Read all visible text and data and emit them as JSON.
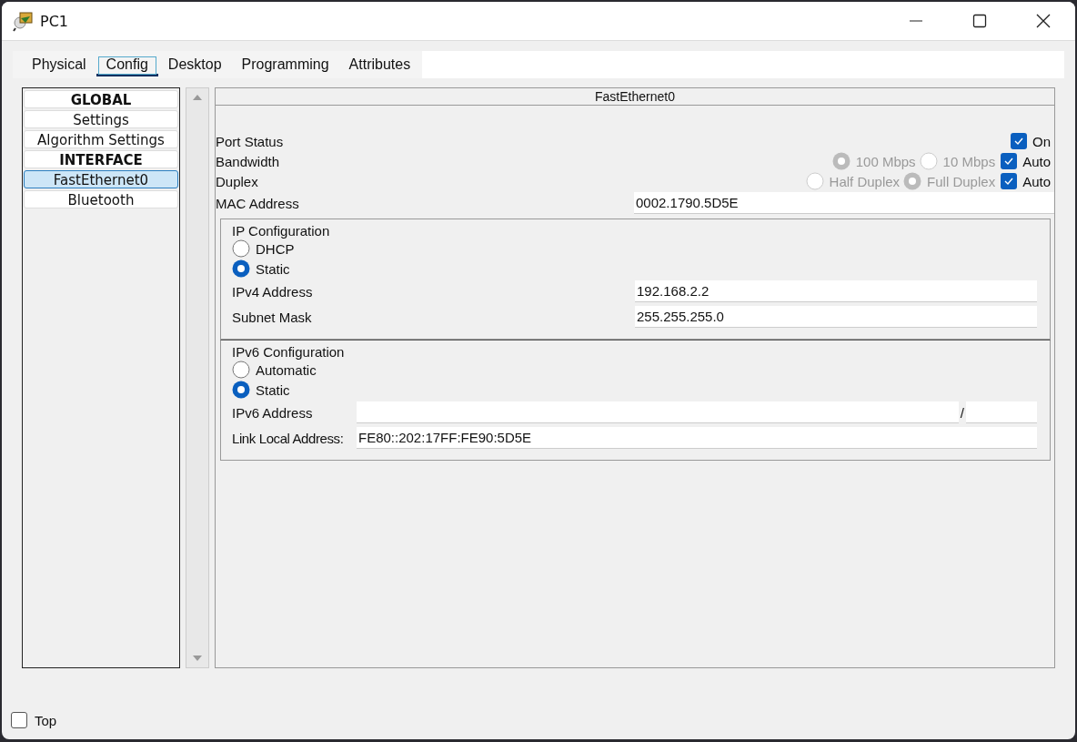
{
  "window": {
    "title": "PC1"
  },
  "tabs": [
    {
      "label": "Physical",
      "selected": false
    },
    {
      "label": "Config",
      "selected": true
    },
    {
      "label": "Desktop",
      "selected": false
    },
    {
      "label": "Programming",
      "selected": false
    },
    {
      "label": "Attributes",
      "selected": false
    }
  ],
  "sidebar": {
    "items": [
      {
        "label": "GLOBAL",
        "kind": "heading",
        "selected": false
      },
      {
        "label": "Settings",
        "kind": "item",
        "selected": false
      },
      {
        "label": "Algorithm Settings",
        "kind": "item",
        "selected": false
      },
      {
        "label": "INTERFACE",
        "kind": "heading",
        "selected": false
      },
      {
        "label": "FastEthernet0",
        "kind": "item",
        "selected": true
      },
      {
        "label": "Bluetooth",
        "kind": "item",
        "selected": false
      }
    ]
  },
  "panel": {
    "title": "FastEthernet0",
    "port_status": {
      "label": "Port Status",
      "checkbox": {
        "label": "On",
        "checked": true
      }
    },
    "bandwidth": {
      "label": "Bandwidth",
      "disabled": true,
      "options": [
        {
          "label": "100 Mbps",
          "selected": true
        },
        {
          "label": "10 Mbps",
          "selected": false
        }
      ],
      "auto": {
        "label": "Auto",
        "checked": true
      }
    },
    "duplex": {
      "label": "Duplex",
      "disabled": true,
      "options": [
        {
          "label": "Half Duplex",
          "selected": false
        },
        {
          "label": "Full Duplex",
          "selected": true
        }
      ],
      "auto": {
        "label": "Auto",
        "checked": true
      }
    },
    "mac_address": {
      "label": "MAC Address",
      "value": "0002.1790.5D5E"
    },
    "ip_configuration": {
      "title": "IP Configuration",
      "modes": [
        {
          "label": "DHCP",
          "selected": false
        },
        {
          "label": "Static",
          "selected": true
        }
      ],
      "fields": [
        {
          "label": "IPv4 Address",
          "value": "192.168.2.2"
        },
        {
          "label": "Subnet Mask",
          "value": "255.255.255.0"
        }
      ]
    },
    "ipv6_configuration": {
      "title": "IPv6 Configuration",
      "modes": [
        {
          "label": "Automatic",
          "selected": false
        },
        {
          "label": "Static",
          "selected": true
        }
      ],
      "address": {
        "label": "IPv6 Address",
        "separator": "/"
      },
      "link_local": {
        "label": "Link Local Address:",
        "value": "FE80::202:17FF:FE90:5D5E"
      }
    }
  },
  "footer": {
    "top": {
      "label": "Top",
      "checked": false
    }
  }
}
